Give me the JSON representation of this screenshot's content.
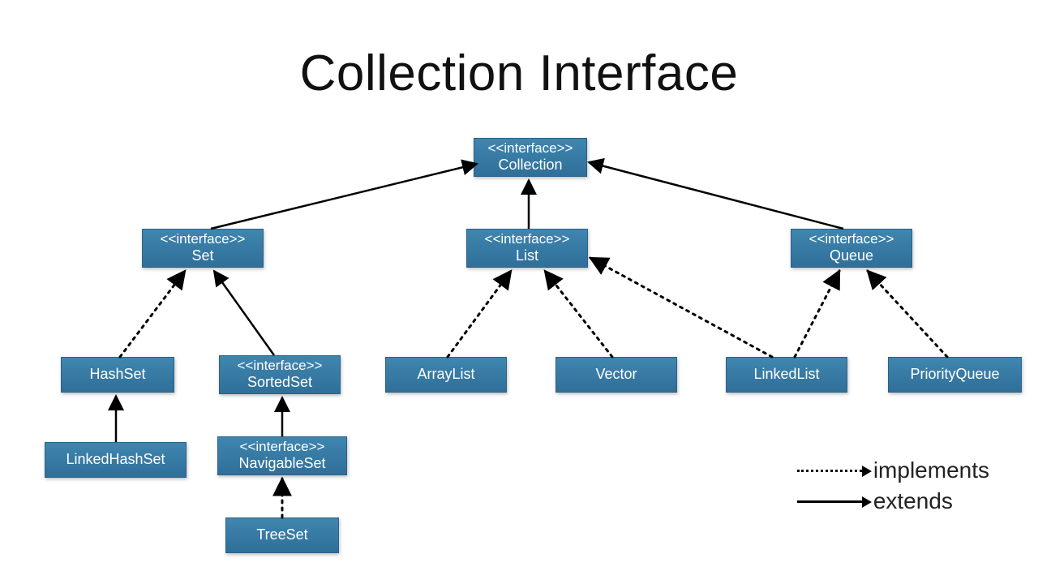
{
  "title": "Collection Interface",
  "stereotype": "<<interface>>",
  "nodes": {
    "collection": {
      "label": "Collection",
      "interface": true
    },
    "set": {
      "label": "Set",
      "interface": true
    },
    "list": {
      "label": "List",
      "interface": true
    },
    "queue": {
      "label": "Queue",
      "interface": true
    },
    "hashset": {
      "label": "HashSet",
      "interface": false
    },
    "sortedset": {
      "label": "SortedSet",
      "interface": true
    },
    "linkedhashset": {
      "label": "LinkedHashSet",
      "interface": false
    },
    "navigableset": {
      "label": "NavigableSet",
      "interface": true
    },
    "treeset": {
      "label": "TreeSet",
      "interface": false
    },
    "arraylist": {
      "label": "ArrayList",
      "interface": false
    },
    "vector": {
      "label": "Vector",
      "interface": false
    },
    "linkedlist": {
      "label": "LinkedList",
      "interface": false
    },
    "priorityqueue": {
      "label": "PriorityQueue",
      "interface": false
    }
  },
  "legend": {
    "implements": "implements",
    "extends": "extends"
  },
  "relations": [
    {
      "from": "set",
      "to": "collection",
      "kind": "extends"
    },
    {
      "from": "list",
      "to": "collection",
      "kind": "extends"
    },
    {
      "from": "queue",
      "to": "collection",
      "kind": "extends"
    },
    {
      "from": "hashset",
      "to": "set",
      "kind": "implements"
    },
    {
      "from": "sortedset",
      "to": "set",
      "kind": "extends"
    },
    {
      "from": "linkedhashset",
      "to": "hashset",
      "kind": "extends"
    },
    {
      "from": "navigableset",
      "to": "sortedset",
      "kind": "extends"
    },
    {
      "from": "treeset",
      "to": "navigableset",
      "kind": "implements"
    },
    {
      "from": "arraylist",
      "to": "list",
      "kind": "implements"
    },
    {
      "from": "vector",
      "to": "list",
      "kind": "implements"
    },
    {
      "from": "linkedlist",
      "to": "list",
      "kind": "implements"
    },
    {
      "from": "linkedlist",
      "to": "queue",
      "kind": "implements"
    },
    {
      "from": "priorityqueue",
      "to": "queue",
      "kind": "implements"
    }
  ],
  "colors": {
    "node_fill": "#367fa9",
    "node_text": "#ffffff",
    "line": "#000000"
  }
}
